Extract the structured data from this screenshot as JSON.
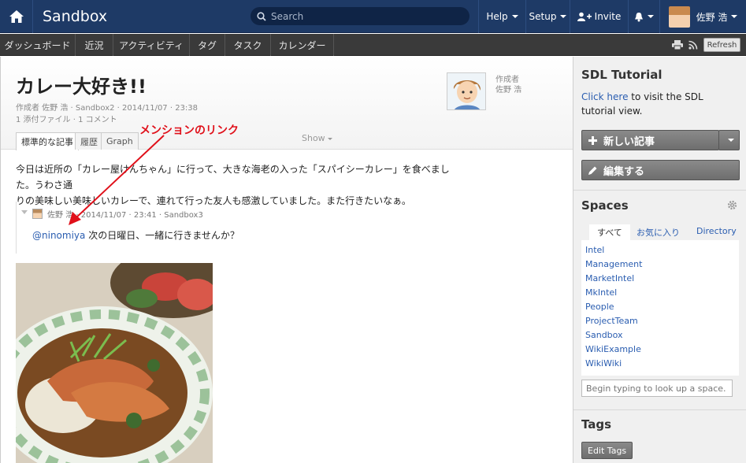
{
  "topbar": {
    "brand": "Sandbox",
    "search_placeholder": "Search",
    "help": "Help",
    "setup": "Setup",
    "invite": "Invite",
    "user_name": "佐野 浩"
  },
  "subnav": [
    "ダッシュボード",
    "近況",
    "アクティビティ",
    "タグ",
    "タスク",
    "カレンダー"
  ],
  "refresh_label": "Refresh",
  "page": {
    "title": "カレー大好き!!",
    "meta_line1": "作成者 佐野 浩 · Sandbox2 · 2014/11/07 · 23:38",
    "meta_line2": "1 添付ファイル · 1 コメント",
    "author_label": "作成者",
    "author_name": "佐野 浩",
    "tabs": [
      "標準的な記事",
      "履歴",
      "Graph"
    ],
    "show_label": "Show",
    "annotation": "メンションのリンク",
    "body_line1": "今日は近所の「カレー屋けんちゃん」に行って、大きな海老の入った「スパイシーカレー」を食べました。うわさ通",
    "body_line2": "りの美味しい美味しいカレーで、連れて行った友人も感激していました。また行きたいなぁ。",
    "comment_meta": "佐野 浩 · 2014/11/07 · 23:41 · Sandbox3",
    "comment_mention": "@ninomiya",
    "comment_text": " 次の日曜日、一緒に行きませんか？"
  },
  "sidebar": {
    "tutorial_title": "SDL Tutorial",
    "tutorial_link": "Click here",
    "tutorial_text": " to visit the SDL tutorial view.",
    "new_article": "新しい記事",
    "edit": "編集する",
    "spaces_title": "Spaces",
    "space_tabs": [
      "すべて",
      "お気に入り",
      "Directory"
    ],
    "spaces": [
      "Intel",
      "Management",
      "MarketIntel",
      "MkIntel",
      "People",
      "ProjectTeam",
      "Sandbox",
      "WikiExample",
      "WikiWiki"
    ],
    "space_search_placeholder": "Begin typing to look up a space.",
    "tags_title": "Tags",
    "edit_tags": "Edit Tags"
  }
}
